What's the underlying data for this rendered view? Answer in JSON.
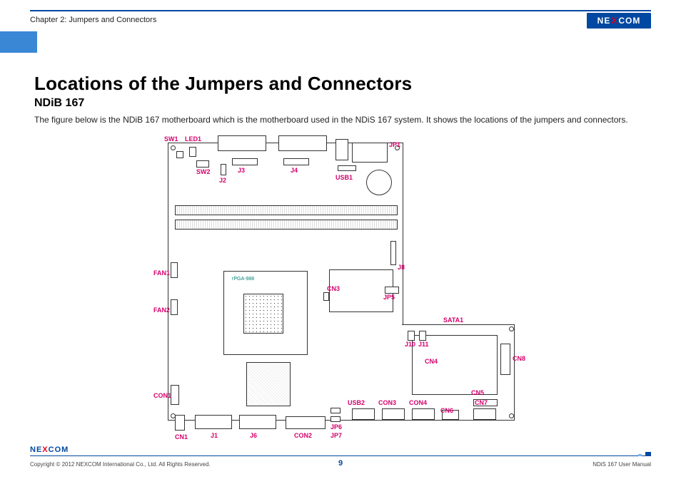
{
  "header": {
    "chapter": "Chapter 2: Jumpers and Connectors",
    "brand": "NEXCOM"
  },
  "title": "Locations of the Jumpers and Connectors",
  "model": "NDiB 167",
  "description": "The figure below is the NDiB 167 motherboard which is the motherboard used in the NDiS 167 system. It shows the locations of the jumpers and connectors.",
  "diagram": {
    "socket_text": "rPGA-988",
    "labels": {
      "SW1": "SW1",
      "LED1": "LED1",
      "SW2": "SW2",
      "J2": "J2",
      "J3": "J3",
      "J4": "J4",
      "JP1": "JP1",
      "USB1": "USB1",
      "FAN1": "FAN1",
      "FAN2": "FAN2",
      "J8": "J8",
      "CN3": "CN3",
      "JP5": "JP5",
      "SATA1": "SATA1",
      "J10": "J10",
      "J11": "J11",
      "CN4": "CN4",
      "CN8": "CN8",
      "CN5": "CN5",
      "CON1": "CON1",
      "USB2": "USB2",
      "CON3": "CON3",
      "CON4": "CON4",
      "CN6": "CN6",
      "CN7": "CN7",
      "JP6": "JP6",
      "JP7": "JP7",
      "CON2": "CON2",
      "J6": "J6",
      "J1": "J1",
      "CN1": "CN1"
    }
  },
  "footer": {
    "brand": "NEXCOM",
    "copyright": "Copyright © 2012 NEXCOM International Co., Ltd. All Rights Reserved.",
    "page": "9",
    "manual": "NDiS 167 User Manual"
  }
}
